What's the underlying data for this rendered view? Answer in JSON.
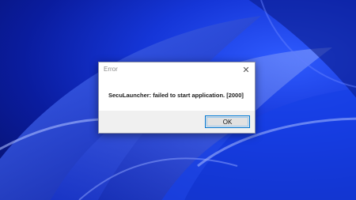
{
  "dialog": {
    "title": "Error",
    "message": "SecuLauncher: failed to start application. [2000]",
    "close_glyph": "✕",
    "ok_label": "OK"
  },
  "desktop": {
    "wallpaper_colors": [
      "#061066",
      "#0a1c9e",
      "#1536d8",
      "#2f5bff",
      "#6f8cff"
    ]
  }
}
